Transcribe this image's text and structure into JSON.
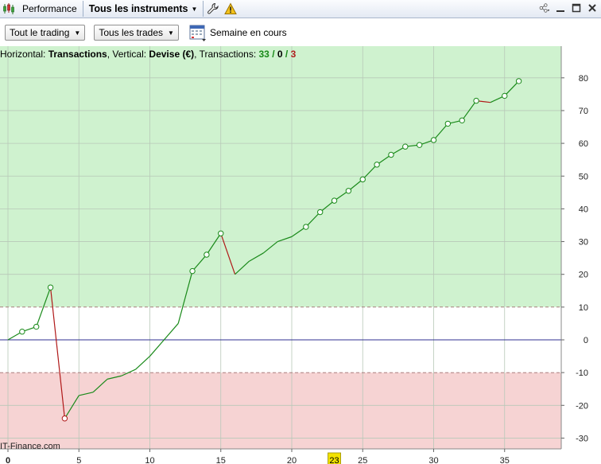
{
  "toolbar": {
    "performance_label": "Performance",
    "instruments_label": "Tous les instruments"
  },
  "subbar": {
    "trading_dropdown": "Tout le trading",
    "trades_dropdown": "Tous les trades",
    "period_label": "Semaine en cours"
  },
  "info": {
    "horizontal_prefix": "Horizontal: ",
    "horizontal_value": "Transactions",
    "vertical_prefix": ", Vertical: ",
    "vertical_value": "Devise (€)",
    "transactions_prefix": ", Transactions: ",
    "wins": "33",
    "sep1": " / ",
    "neutral": "0",
    "sep2": " / ",
    "losses": "3"
  },
  "watermark": "IT-Finance.com",
  "colors": {
    "positive_zone": "#cff2cf",
    "negative_zone": "#f6d3d3",
    "up_line": "#1a8a1a",
    "down_line": "#b01818",
    "zero_line": "#303090"
  },
  "chart_data": {
    "type": "line",
    "xlim": [
      0,
      38.5
    ],
    "ylim": [
      -33,
      90
    ],
    "x_ticks": [
      0,
      5,
      10,
      15,
      20,
      25,
      30,
      35
    ],
    "y_ticks": [
      -30,
      -20,
      -10,
      0,
      10,
      20,
      30,
      40,
      50,
      60,
      70,
      80
    ],
    "highlighted_x": 23,
    "bands": {
      "positive_threshold": 10,
      "negative_threshold": -10
    },
    "grid": true,
    "y_axis_position": "right",
    "points": [
      {
        "x": 0,
        "y": 0,
        "marker": false
      },
      {
        "x": 1,
        "y": 2.5,
        "marker": true
      },
      {
        "x": 2,
        "y": 4,
        "marker": true
      },
      {
        "x": 3,
        "y": 16,
        "marker": true
      },
      {
        "x": 4,
        "y": -24,
        "marker": true
      },
      {
        "x": 5,
        "y": -17,
        "marker": false
      },
      {
        "x": 6,
        "y": -16,
        "marker": false
      },
      {
        "x": 7,
        "y": -12,
        "marker": false
      },
      {
        "x": 8,
        "y": -11,
        "marker": false
      },
      {
        "x": 9,
        "y": -9,
        "marker": false
      },
      {
        "x": 10,
        "y": -5,
        "marker": false
      },
      {
        "x": 11,
        "y": 0,
        "marker": false
      },
      {
        "x": 12,
        "y": 5,
        "marker": false
      },
      {
        "x": 13,
        "y": 21,
        "marker": true
      },
      {
        "x": 14,
        "y": 26,
        "marker": true
      },
      {
        "x": 15,
        "y": 32.5,
        "marker": true
      },
      {
        "x": 16,
        "y": 20,
        "marker": false
      },
      {
        "x": 17,
        "y": 24,
        "marker": false
      },
      {
        "x": 18,
        "y": 26.5,
        "marker": false
      },
      {
        "x": 19,
        "y": 30,
        "marker": false
      },
      {
        "x": 20,
        "y": 31.5,
        "marker": false
      },
      {
        "x": 21,
        "y": 34.5,
        "marker": true
      },
      {
        "x": 22,
        "y": 39,
        "marker": true
      },
      {
        "x": 23,
        "y": 42.5,
        "marker": true
      },
      {
        "x": 24,
        "y": 45.5,
        "marker": true
      },
      {
        "x": 25,
        "y": 49,
        "marker": true
      },
      {
        "x": 26,
        "y": 53.5,
        "marker": true
      },
      {
        "x": 27,
        "y": 56.5,
        "marker": true
      },
      {
        "x": 28,
        "y": 59,
        "marker": true
      },
      {
        "x": 29,
        "y": 59.5,
        "marker": true
      },
      {
        "x": 30,
        "y": 61,
        "marker": true
      },
      {
        "x": 31,
        "y": 66,
        "marker": true
      },
      {
        "x": 32,
        "y": 67,
        "marker": true
      },
      {
        "x": 33,
        "y": 73,
        "marker": true
      },
      {
        "x": 34,
        "y": 72.5,
        "marker": false
      },
      {
        "x": 35,
        "y": 74.5,
        "marker": true
      },
      {
        "x": 36,
        "y": 79,
        "marker": true
      }
    ]
  }
}
